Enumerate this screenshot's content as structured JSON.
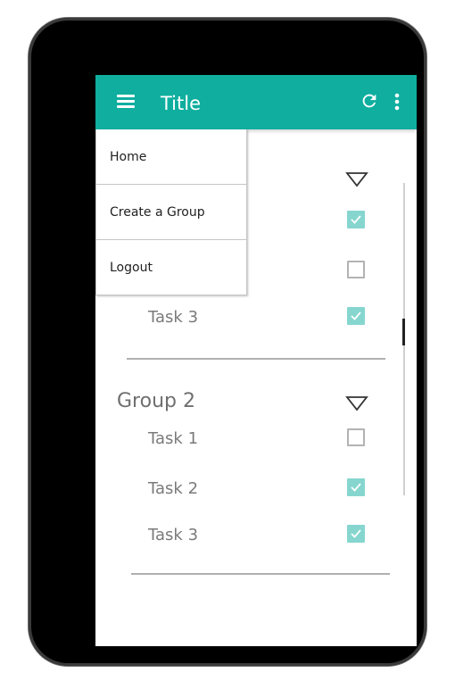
{
  "app_bar": {
    "title": "Title",
    "left_icon": "hamburger-menu-icon",
    "right_icons": [
      "refresh-icon",
      "overflow-menu-icon"
    ],
    "color": "#0fae9f"
  },
  "dropdown_menu": {
    "items": [
      {
        "label": "Home"
      },
      {
        "label": "Create a Group"
      },
      {
        "label": "Logout"
      }
    ]
  },
  "groups": [
    {
      "title": "",
      "tasks": [
        {
          "label": "",
          "checked": true
        },
        {
          "label": "",
          "checked": false
        },
        {
          "label": "Task 3",
          "checked": true
        }
      ]
    },
    {
      "title": "Group 2",
      "tasks": [
        {
          "label": "Task 1",
          "checked": false
        },
        {
          "label": "Task 2",
          "checked": true
        },
        {
          "label": "Task 3",
          "checked": true
        }
      ]
    }
  ],
  "colors": {
    "checkbox_checked": "#86d6cf",
    "checkbox_unchecked_border": "#b3b3b3",
    "text_muted": "#7a7a7a"
  }
}
